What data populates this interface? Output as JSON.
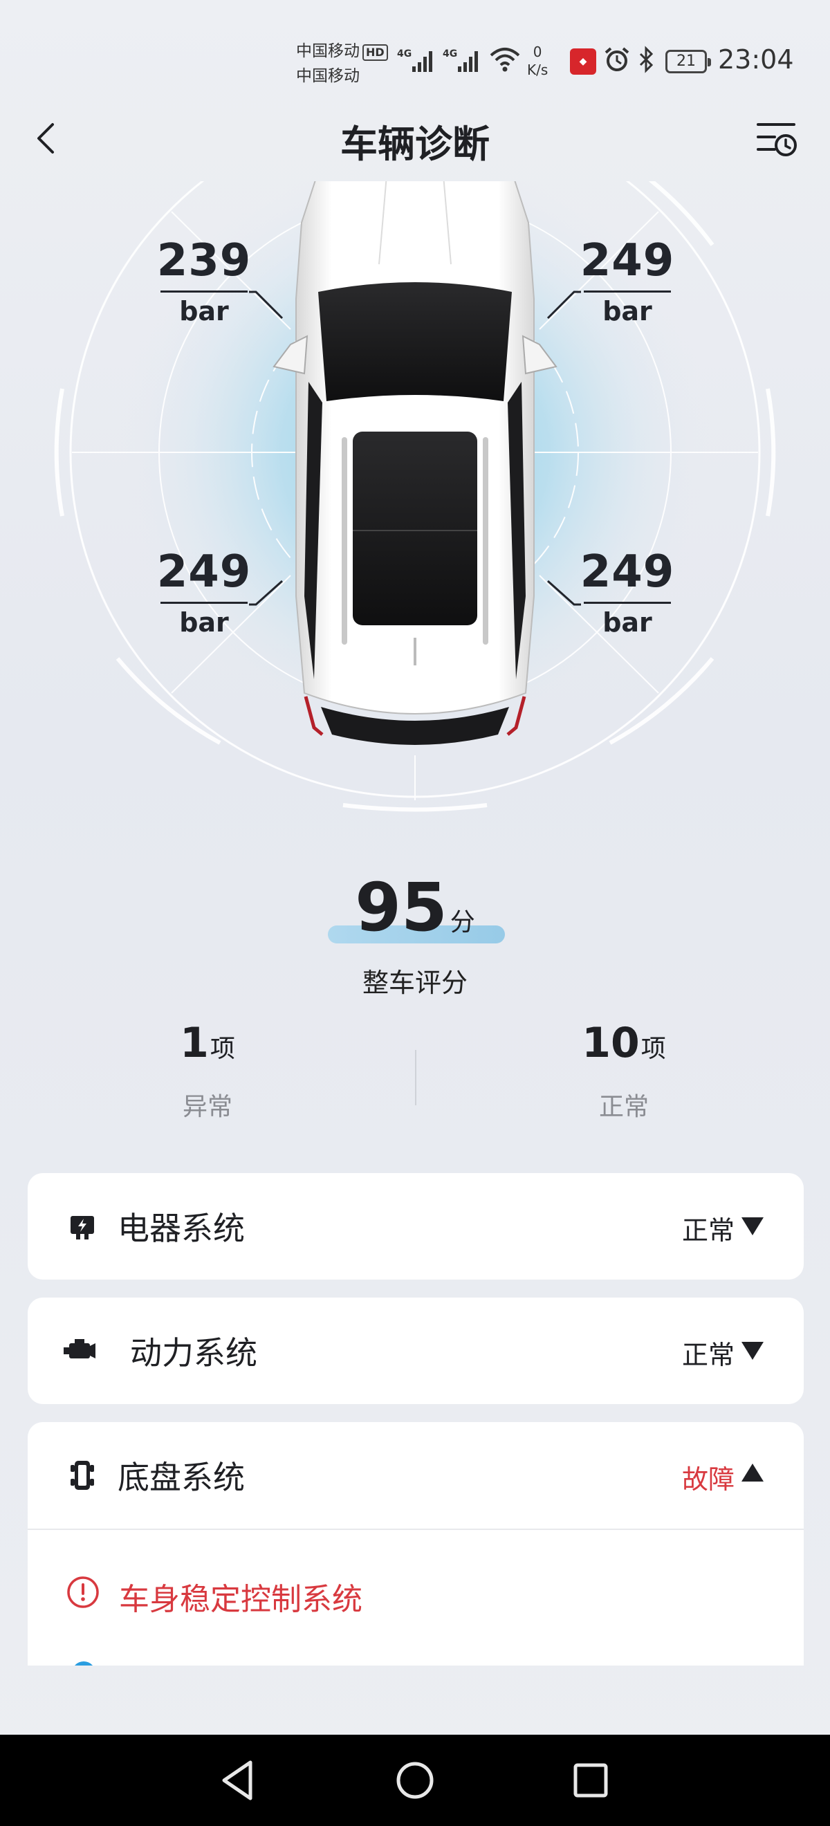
{
  "status_bar": {
    "carrier_1": "中国移动",
    "hd_badge": "HD",
    "carrier_2": "中国移动",
    "net_speed_value": "0",
    "net_speed_unit": "K/s",
    "battery": "21",
    "time": "23:04"
  },
  "header": {
    "title": "车辆诊断",
    "back_icon": "chevron-left-icon",
    "history_icon": "list-clock-icon"
  },
  "tire_pressure": {
    "front_left": {
      "value": "239",
      "unit": "bar"
    },
    "front_right": {
      "value": "249",
      "unit": "bar"
    },
    "rear_left": {
      "value": "249",
      "unit": "bar"
    },
    "rear_right": {
      "value": "249",
      "unit": "bar"
    }
  },
  "score": {
    "value": "95",
    "unit": "分",
    "label": "整车评分"
  },
  "summary": {
    "abnormal": {
      "count": "1",
      "unit": "项",
      "label": "异常"
    },
    "normal": {
      "count": "10",
      "unit": "项",
      "label": "正常"
    }
  },
  "systems": [
    {
      "name": "电器系统",
      "status": "正常",
      "icon": "electrical-icon",
      "expanded": false
    },
    {
      "name": "动力系统",
      "status": "正常",
      "icon": "engine-icon",
      "expanded": false
    },
    {
      "name": "底盘系统",
      "status": "故障",
      "icon": "chassis-icon",
      "expanded": true,
      "issues": [
        {
          "name": "车身稳定控制系统",
          "icon": "alert-circle-icon"
        }
      ]
    }
  ],
  "colors": {
    "fault": "#d8393f",
    "accent_blue": "#8ec7e6"
  }
}
